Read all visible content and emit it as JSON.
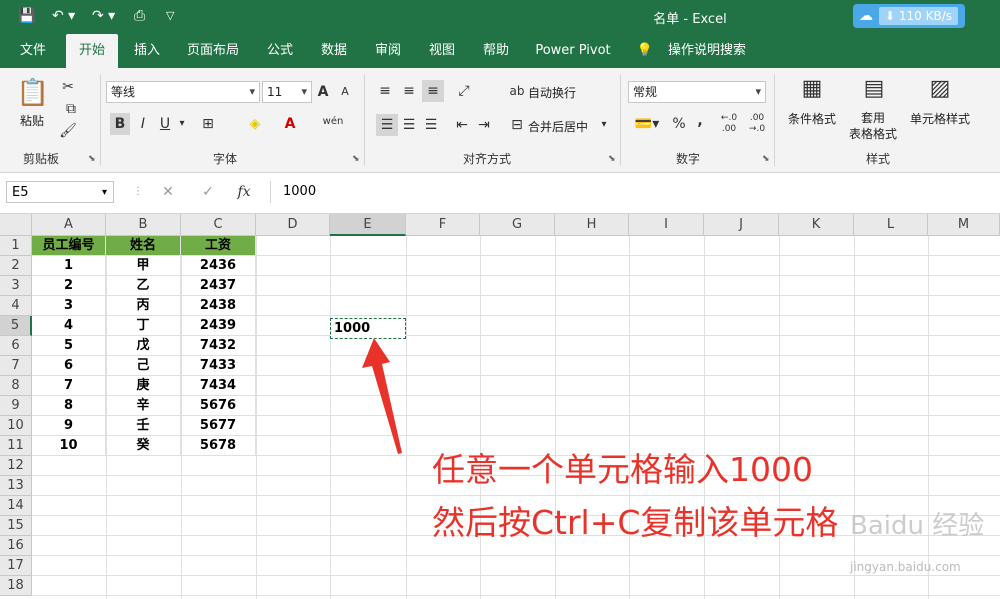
{
  "window": {
    "title": "名单 - Excel",
    "net_speed": "110 KB/s"
  },
  "quick_access": {
    "save_icon": "save-icon",
    "undo_icon": "undo-icon",
    "redo_icon": "redo-icon",
    "preview_icon": "print-preview-icon",
    "customize_icon": "customize-icon"
  },
  "tabs": [
    "文件",
    "开始",
    "插入",
    "页面布局",
    "公式",
    "数据",
    "审阅",
    "视图",
    "帮助",
    "Power Pivot",
    "操作说明搜索"
  ],
  "ribbon": {
    "clipboard": {
      "paste": "粘贴",
      "label": "剪贴板"
    },
    "font": {
      "name": "等线",
      "size": "11",
      "bold": "B",
      "italic": "I",
      "underline": "U",
      "label": "字体",
      "grow": "A",
      "shrink": "A",
      "phonetic": "wén"
    },
    "alignment": {
      "wrap": "自动换行",
      "merge": "合并后居中",
      "label": "对齐方式"
    },
    "number": {
      "format": "常规",
      "percent": "%",
      "comma": ",",
      "label": "数字"
    },
    "styles": {
      "conditional": "条件格式",
      "table_format": "套用\n表格格式",
      "cell_styles": "单元格样式",
      "label": "样式"
    }
  },
  "formula_bar": {
    "name_box": "E5",
    "formula": "1000",
    "fx": "fx",
    "cancel": "✕",
    "enter": "✓"
  },
  "columns": [
    "A",
    "B",
    "C",
    "D",
    "E",
    "F",
    "G",
    "H",
    "I",
    "J",
    "K",
    "L",
    "M"
  ],
  "rows": [
    "1",
    "2",
    "3",
    "4",
    "5",
    "6",
    "7",
    "8",
    "9",
    "10",
    "11",
    "12",
    "13",
    "14",
    "15",
    "16",
    "17",
    "18"
  ],
  "table": {
    "headers": [
      "员工编号",
      "姓名",
      "工资"
    ],
    "rows": [
      [
        "1",
        "甲",
        "2436"
      ],
      [
        "2",
        "乙",
        "2437"
      ],
      [
        "3",
        "丙",
        "2438"
      ],
      [
        "4",
        "丁",
        "2439"
      ],
      [
        "5",
        "戊",
        "7432"
      ],
      [
        "6",
        "己",
        "7433"
      ],
      [
        "7",
        "庚",
        "7434"
      ],
      [
        "8",
        "辛",
        "5676"
      ],
      [
        "9",
        "壬",
        "5677"
      ],
      [
        "10",
        "癸",
        "5678"
      ]
    ]
  },
  "selected_cell": {
    "ref": "E5",
    "value": "1000"
  },
  "annotation": {
    "line1": "任意一个单元格输入1000",
    "line2": "然后按Ctrl+C复制该单元格"
  },
  "watermark": {
    "text": "Baidu 经验",
    "url": "jingyan.baidu.com"
  },
  "colors": {
    "excel_green": "#217346",
    "header_fill": "#70ad47",
    "annotation": "#e8332a"
  }
}
